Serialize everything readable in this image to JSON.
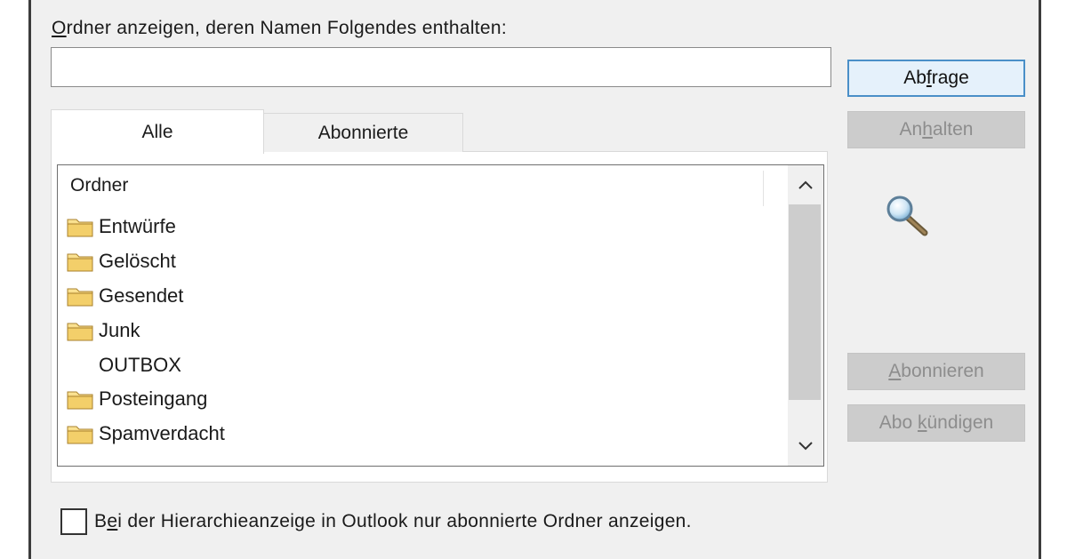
{
  "search": {
    "label_prefix": "",
    "label_accel": "O",
    "label_rest": "rdner anzeigen, deren Namen Folgendes enthalten:",
    "value": "",
    "placeholder": ""
  },
  "buttons": {
    "query": {
      "pre": "Ab",
      "accel": "f",
      "post": "rage"
    },
    "stop": {
      "pre": "An",
      "accel": "h",
      "post": "alten"
    },
    "subscribe": {
      "pre": "",
      "accel": "A",
      "post": "bonnieren"
    },
    "unsubscribe": {
      "pre": "Abo ",
      "accel": "k",
      "post": "ündigen"
    }
  },
  "tabs": [
    {
      "label": "Alle",
      "selected": true
    },
    {
      "label": "Abonnierte",
      "selected": false
    }
  ],
  "folder_list": {
    "column_header": "Ordner",
    "items": [
      {
        "name": "Entwürfe",
        "icon": "folder-icon"
      },
      {
        "name": "Gelöscht",
        "icon": "folder-icon"
      },
      {
        "name": "Gesendet",
        "icon": "folder-icon"
      },
      {
        "name": "Junk",
        "icon": "folder-icon"
      },
      {
        "name": "OUTBOX",
        "icon": ""
      },
      {
        "name": "Posteingang",
        "icon": "folder-icon"
      },
      {
        "name": "Spamverdacht",
        "icon": "folder-icon"
      }
    ]
  },
  "checkbox": {
    "checked": false,
    "label_pre": "B",
    "label_accel": "e",
    "label_post": "i der Hierarchieanzeige in Outlook nur abonnierte Ordner anzeigen."
  },
  "colors": {
    "dialog_bg": "#f0f0f0",
    "accent_border": "#4a8fc8",
    "folder_yellow": "#e8b64a"
  }
}
